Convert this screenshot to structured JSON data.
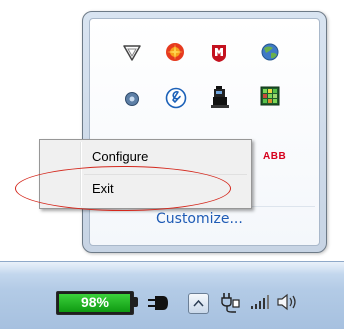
{
  "tray_overflow": {
    "customize_label": "Customize...",
    "abb_label": "ABB",
    "icons": [
      "triangle-outline-icon",
      "orange-sun-icon",
      "mcafee-shield-icon",
      "blue-green-globe-icon",
      "blue-disc-icon",
      "wrench-circle-icon",
      "black-tower-icon",
      "green-grid-icon",
      "abb-logo"
    ]
  },
  "context_menu": {
    "items": [
      {
        "label": "Configure"
      },
      {
        "label": "Exit"
      }
    ]
  },
  "taskbar": {
    "battery_percent_label": "98%",
    "battery_level": 0.98,
    "icons": [
      "power-plug-icon",
      "show-hidden-icons-chevron-up-icon",
      "network-plug-icon",
      "signal-bars-icon",
      "speaker-icon"
    ]
  },
  "colors": {
    "annotation_ellipse": "#d4281d",
    "link": "#1e5bb5",
    "battery_fill": "#20b623"
  }
}
